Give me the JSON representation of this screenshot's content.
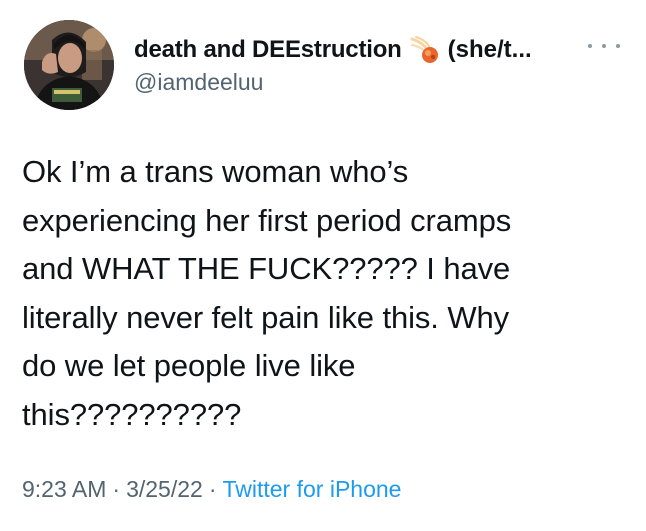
{
  "author": {
    "display_name": "death and DEEstruction",
    "pronouns": "(she/t...",
    "handle": "@iamdeeluu",
    "name_emoji": "comet-icon",
    "avatar_icon": "profile-photo"
  },
  "tweet": {
    "text": "Ok I’m a trans woman who’s\nexperiencing her first period cramps\nand WHAT THE FUCK????? I have\nliterally never felt pain like this. Why\ndo we let people live like\nthis??????????",
    "time": "9:23 AM",
    "date": "3/25/22",
    "separator": "·",
    "source": "Twitter for iPhone"
  },
  "menu": {
    "icon": "more-options-icon"
  },
  "colors": {
    "text": "#0f1419",
    "secondary": "#536471",
    "link": "#1d9bf0"
  }
}
